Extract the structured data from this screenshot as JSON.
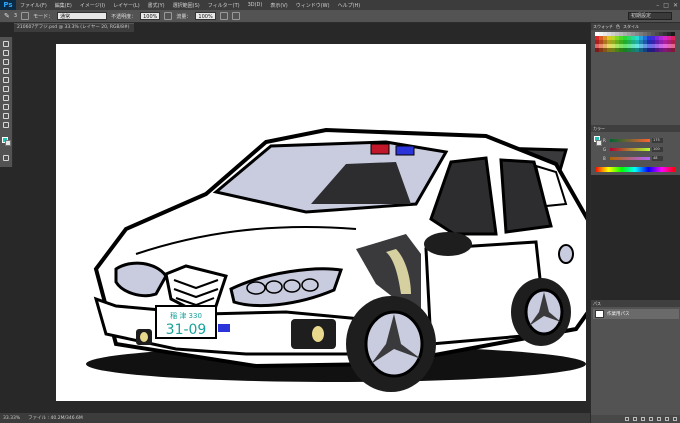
{
  "app": {
    "logo": "Ps",
    "menus": [
      "ファイル(F)",
      "編集(E)",
      "イメージ(I)",
      "レイヤー(L)",
      "書式(Y)",
      "選択範囲(S)",
      "フィルター(T)",
      "3D(D)",
      "表示(V)",
      "ウィンドウ(W)",
      "ヘルプ(H)"
    ]
  },
  "options": {
    "brush_size": "3",
    "mode_label": "モード：",
    "mode_value": "通常",
    "opacity_label": "不透明度：",
    "opacity_value": "100%",
    "flow_label": "流量：",
    "flow_value": "100%",
    "workspace": "初期設定"
  },
  "document": {
    "tab_title": "210607デフジ.psd @ 33.3% (レイヤー 20, RGB/8#)"
  },
  "panels": {
    "swatches_tabs": [
      "スウォッチ",
      "色",
      "スタイル"
    ],
    "color_tab": "カラー",
    "color_values": {
      "R": "175",
      "G": "100",
      "B": "48"
    },
    "layers_tab": "パス",
    "layer_name": "作業用パス"
  },
  "status": {
    "zoom": "33.33%",
    "file_info": "ファイル : 40.2M/346.6M"
  },
  "colors": {
    "foreground": "#24c2b4",
    "background": "#e8e8e8",
    "car_window": "#c9ccdf",
    "car_panel": "#3a3a3c",
    "plate_text": "#1aa39a"
  },
  "canvas_art": {
    "plate_top": "稲 津 330",
    "plate_number": "31-09"
  }
}
